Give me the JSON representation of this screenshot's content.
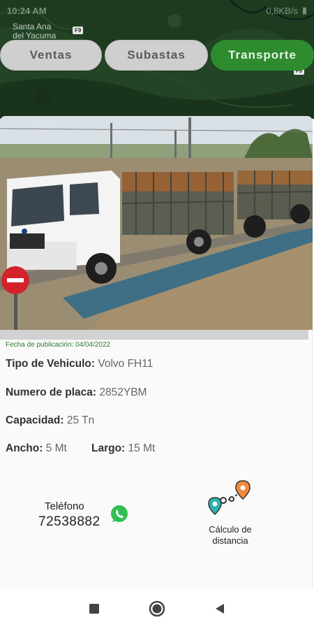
{
  "status_bar": {
    "time": "10:24 AM",
    "right_text": "0,8KB/s"
  },
  "map": {
    "place_label_line1": "Santa Ana",
    "place_label_line2": "del Yacuma",
    "route_badge": "F9",
    "route_badge2": "F9"
  },
  "tabs": [
    {
      "label": "Ventas",
      "active": false
    },
    {
      "label": "Subastas",
      "active": false
    },
    {
      "label": "Transporte",
      "active": true
    }
  ],
  "listing": {
    "publication_date": "Fecha de publicación: 04/04/2022",
    "vehicle_type_label": "Tipo de Vehiculo:",
    "vehicle_type_value": "Volvo FH11",
    "plate_label": "Numero de placa:",
    "plate_value": "2852YBM",
    "capacity_label": "Capacidad:",
    "capacity_value": "25 Tn",
    "width_label": "Ancho:",
    "width_value": "5 Mt",
    "length_label": "Largo:",
    "length_value": "15 Mt",
    "phone_label": "Teléfono",
    "phone_number": "72538882",
    "distance_label_line1": "Cálculo de",
    "distance_label_line2": "distancia",
    "photo_icon": "truck-photo"
  },
  "icons": {
    "whatsapp": "whatsapp-icon",
    "route": "route-distance-icon",
    "nav_recent": "square-icon",
    "nav_home": "circle-icon",
    "nav_back": "triangle-back-icon"
  },
  "colors": {
    "accent": "#2e8b2e",
    "date_green": "#2e7d32",
    "tab_inactive": "#cfcfcf",
    "whatsapp": "#2fbf52",
    "pin_orange": "#f08a3c",
    "pin_teal": "#2ab3b0"
  }
}
